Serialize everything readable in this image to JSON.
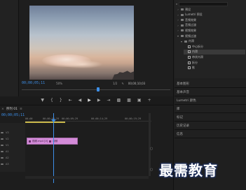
{
  "monitor": {
    "timecode_current": "00;00;05;11",
    "zoom": "50%",
    "resolution": "1/2",
    "timecode_duration": "00;00;10;03"
  },
  "transport": {
    "buttons": [
      "mark-in",
      "mark-out",
      "go-to-in",
      "step-back",
      "play",
      "step-forward",
      "go-to-out",
      "insert",
      "overwrite",
      "export-frame",
      "add"
    ]
  },
  "effects_panel": {
    "tab_label": "效果",
    "tree": [
      {
        "label": "预设",
        "level": 0,
        "type": "folder"
      },
      {
        "label": "Lumetri 预设",
        "level": 0,
        "type": "folder"
      },
      {
        "label": "音频效果",
        "level": 0,
        "type": "folder"
      },
      {
        "label": "音频过渡",
        "level": 0,
        "type": "folder"
      },
      {
        "label": "视频效果",
        "level": 0,
        "type": "folder"
      },
      {
        "label": "视频过渡",
        "level": 0,
        "type": "folder",
        "expanded": true
      },
      {
        "label": "内滑",
        "level": 1,
        "type": "folder",
        "expanded": true
      },
      {
        "label": "中心拆分",
        "level": 2,
        "type": "effect"
      },
      {
        "label": "内滑",
        "level": 2,
        "type": "effect",
        "selected": true
      },
      {
        "label": "带状内滑",
        "level": 2,
        "type": "effect"
      },
      {
        "label": "拆分",
        "level": 2,
        "type": "effect"
      },
      {
        "label": "推",
        "level": 2,
        "type": "effect"
      }
    ]
  },
  "side_panels": [
    {
      "label": "基本图形"
    },
    {
      "label": "基本声音"
    },
    {
      "label": "Lumetri 颜色"
    },
    {
      "label": "库"
    },
    {
      "label": "标记"
    },
    {
      "label": "历史记录"
    },
    {
      "label": "信息"
    }
  ],
  "timeline": {
    "tab_label": "序列 01",
    "timecode": "00;00;05;11",
    "ruler_labels": [
      "00;00",
      "00;00;04;29",
      "00;00;09;29",
      "00;00;14;29",
      "00;00;19;29"
    ],
    "clip": {
      "label": "视频.mp4 [V]",
      "label2": "视频"
    },
    "track_labels": [
      "V3",
      "V2",
      "V1",
      "A1",
      "A2",
      "A3"
    ]
  },
  "watermark": "最需教育",
  "colors": {
    "accent": "#3d8fe8",
    "clip": "#d38bd8",
    "work_area": "#c9b84a"
  }
}
